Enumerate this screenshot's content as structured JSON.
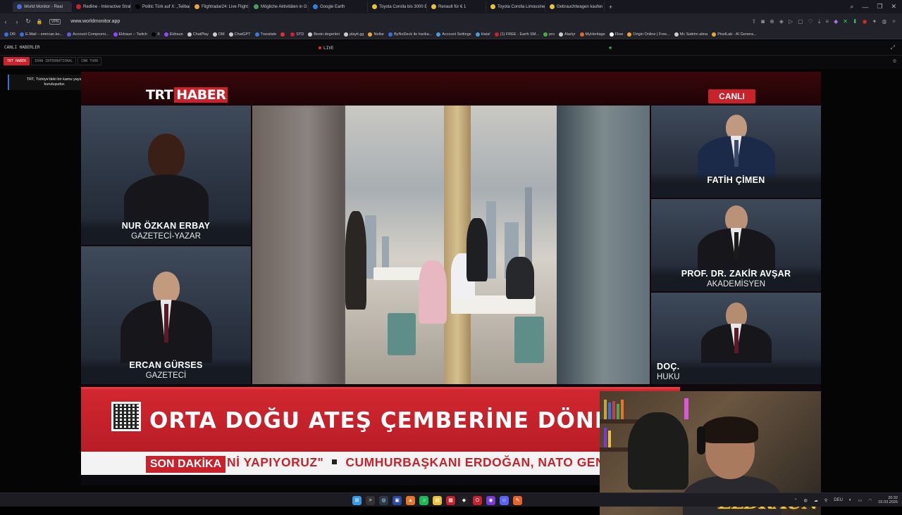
{
  "browser": {
    "tabs": [
      {
        "label": "World Monitor - Real",
        "color": "#4a6fd8",
        "active": true
      },
      {
        "label": "Redline - Interactive Strat",
        "color": "#c8232c"
      },
      {
        "label": "Politic Türk auf X: „Teilban",
        "color": "#000000"
      },
      {
        "label": "Flightradar24: Live Flight",
        "color": "#e8a63a"
      },
      {
        "label": "Mögliche Aktivitäten in G",
        "color": "#4a9a5a"
      },
      {
        "label": "Google Earth",
        "color": "#3a7bd8"
      },
      {
        "label": "Toyota Corolla bis 3000 E",
        "color": "#e8c23a"
      },
      {
        "label": "Renault für € 1",
        "color": "#e8c23a"
      },
      {
        "label": "Toyota Corolla Limousine",
        "color": "#e8c23a"
      },
      {
        "label": "Gebrauchtwagen kaufen l",
        "color": "#e8c23a"
      }
    ],
    "new_tab": "+",
    "window_controls": {
      "search": "⌕",
      "minimize": "—",
      "maximize": "❐",
      "close": "✕"
    },
    "vpn_label": "VPN",
    "url": "www.worldmonitor.app",
    "bookmarks": [
      {
        "label": "DR",
        "color": "#3a6fd8"
      },
      {
        "label": "E-Mail – emircan.ko...",
        "color": "#3a6fd8"
      },
      {
        "label": "Account Compromi...",
        "color": "#6a5ad8"
      },
      {
        "label": "Eldraun – Twitch",
        "color": "#9146ff"
      },
      {
        "label": "X",
        "color": "#000000"
      },
      {
        "label": "Eldraun",
        "color": "#9146ff"
      },
      {
        "label": "ChatPlay",
        "color": "#cccccc"
      },
      {
        "label": "DM",
        "color": "#cccccc"
      },
      {
        "label": "ChatGPT",
        "color": "#cccccc"
      },
      {
        "label": "Translate",
        "color": "#3a7bd8"
      },
      {
        "label": "",
        "color": "#e0302f"
      },
      {
        "label": "STD",
        "color": "#c8232c"
      },
      {
        "label": "Besin degerleri",
        "color": "#cccccc"
      },
      {
        "label": "playit.gg",
        "color": "#cccccc"
      },
      {
        "label": "Notlar",
        "color": "#e8a63a"
      },
      {
        "label": "ByNoDeck ile harika...",
        "color": "#3a6fd8"
      },
      {
        "label": "Account Settings",
        "color": "#4a9ad8"
      },
      {
        "label": "Hata!",
        "color": "#4a9ad8"
      },
      {
        "label": "(1) FREE - Earth SM...",
        "color": "#c8232c"
      },
      {
        "label": "pro",
        "color": "#4aa84a"
      },
      {
        "label": "Alarlyr",
        "color": "#cccccc"
      },
      {
        "label": "MyHeritage",
        "color": "#e8632a"
      },
      {
        "label": "Flow",
        "color": "#ffffff"
      },
      {
        "label": "Origin Online | Free...",
        "color": "#e8a63a"
      },
      {
        "label": "Mc Satirim alma",
        "color": "#cccccc"
      },
      {
        "label": "PixelLab - AI Genera...",
        "color": "#e8a63a"
      }
    ]
  },
  "worldmonitor": {
    "section_title": "CANLI HABERLER",
    "live_label": "LIVE",
    "speaker_icon": "speaker-icon",
    "channel_tabs": [
      {
        "label": "TRT HABER",
        "active": true
      },
      {
        "label": "IRAN INTERNATIONAL",
        "active": false
      },
      {
        "label": "CNN TURK",
        "active": false
      }
    ],
    "info_box": "TRT, Türkiye'deki bir kamu yayın kuruluşudur.",
    "info_arrow": "›"
  },
  "broadcast": {
    "logo_trt": "TRT",
    "logo_haber": "HABER",
    "live_badge": "CANLI",
    "guests_left": [
      {
        "name": "NUR ÖZKAN ERBAY",
        "role": "GAZETECİ-YAZAR"
      },
      {
        "name": "ERCAN GÜRSES",
        "role": "GAZETECİ"
      }
    ],
    "guests_right": [
      {
        "name": "FATİH ÇİMEN",
        "role": ""
      },
      {
        "name": "PROF. DR. ZAKİR AVŞAR",
        "role": "AKADEMİSYEN"
      },
      {
        "name": "DOÇ.",
        "role": "HUKU"
      }
    ],
    "headline": "ORTA DOĞU ATEŞ ÇEMBERİNE DÖNDÜ",
    "ticker_label": "SON DAKİKA",
    "ticker_text_1": "Nİ YAPIYORUZ\"",
    "ticker_text_2": "CUMHURBAŞKANI ERDOĞAN, NATO GENEL SEK",
    "streamer_logo": "ELDRAUN"
  },
  "taskbar": {
    "apps": [
      {
        "name": "start",
        "color": "#3a9ae8",
        "glyph": "⊞"
      },
      {
        "name": "terminal",
        "color": "#333333",
        "glyph": ">"
      },
      {
        "name": "steam",
        "color": "#2a3a4a",
        "glyph": "◎"
      },
      {
        "name": "app-blue",
        "color": "#2a4aa8",
        "glyph": "▣"
      },
      {
        "name": "app-orange",
        "color": "#e8732a",
        "glyph": "▲"
      },
      {
        "name": "spotify",
        "color": "#1db954",
        "glyph": "♫"
      },
      {
        "name": "explorer",
        "color": "#e8c23a",
        "glyph": "▤"
      },
      {
        "name": "app-red",
        "color": "#c8232c",
        "glyph": "▦"
      },
      {
        "name": "app-dark",
        "color": "#222222",
        "glyph": "◆"
      },
      {
        "name": "opera",
        "color": "#c8232c",
        "glyph": "O"
      },
      {
        "name": "app-purple",
        "color": "#7a3ad8",
        "glyph": "◉"
      },
      {
        "name": "discord",
        "color": "#5865f2",
        "glyph": "☺"
      },
      {
        "name": "app-orange2",
        "color": "#e8632a",
        "glyph": "✎"
      }
    ],
    "tray": {
      "language": "DEU",
      "time": "20:32",
      "date": "02.03.2026"
    }
  }
}
